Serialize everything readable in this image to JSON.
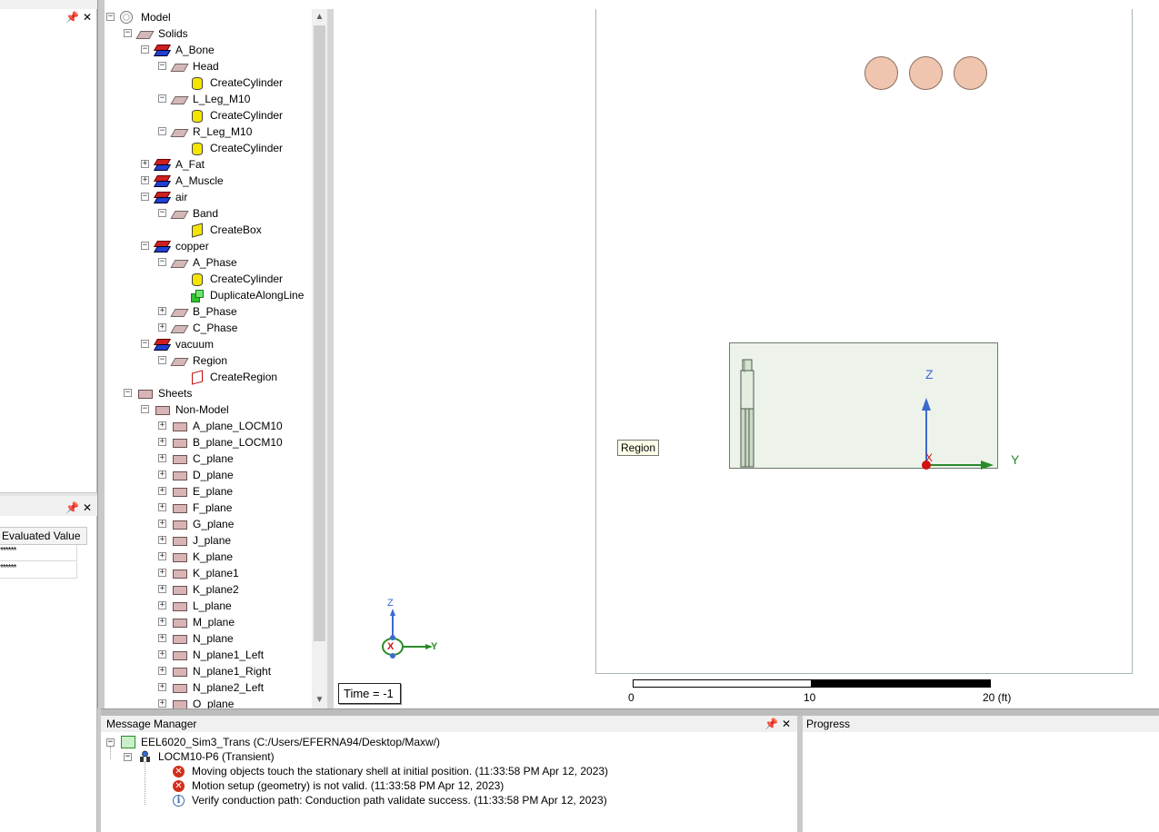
{
  "left_panels": {
    "top": {
      "pin": "📌",
      "close": "✕"
    },
    "bottom": {
      "pin": "📌",
      "close": "✕",
      "column_header": "Evaluated Value",
      "rows": [
        "******",
        "******"
      ]
    }
  },
  "tree": {
    "scroll_up": "▲",
    "scroll_down": "▼",
    "nodes": [
      {
        "label": "Model",
        "expander": "−",
        "icon": "model-icon"
      },
      {
        "label": "Solids",
        "expander": "−",
        "icon": "folder-icon"
      },
      {
        "label": "A_Bone",
        "expander": "−",
        "icon": "material-icon"
      },
      {
        "label": "Head",
        "expander": "−",
        "icon": "object-icon"
      },
      {
        "label": "CreateCylinder",
        "expander": "",
        "icon": "cylinder-icon"
      },
      {
        "label": "L_Leg_M10",
        "expander": "−",
        "icon": "object-icon"
      },
      {
        "label": "CreateCylinder",
        "expander": "",
        "icon": "cylinder-icon"
      },
      {
        "label": "R_Leg_M10",
        "expander": "−",
        "icon": "object-icon"
      },
      {
        "label": "CreateCylinder",
        "expander": "",
        "icon": "cylinder-icon"
      },
      {
        "label": "A_Fat",
        "expander": "+",
        "icon": "material-icon"
      },
      {
        "label": "A_Muscle",
        "expander": "+",
        "icon": "material-icon"
      },
      {
        "label": "air",
        "expander": "−",
        "icon": "material-icon"
      },
      {
        "label": "Band",
        "expander": "−",
        "icon": "object-icon"
      },
      {
        "label": "CreateBox",
        "expander": "",
        "icon": "box-icon"
      },
      {
        "label": "copper",
        "expander": "−",
        "icon": "material-icon"
      },
      {
        "label": "A_Phase",
        "expander": "−",
        "icon": "object-icon"
      },
      {
        "label": "CreateCylinder",
        "expander": "",
        "icon": "cylinder-icon"
      },
      {
        "label": "DuplicateAlongLine",
        "expander": "",
        "icon": "duplicate-icon"
      },
      {
        "label": "B_Phase",
        "expander": "+",
        "icon": "object-icon"
      },
      {
        "label": "C_Phase",
        "expander": "+",
        "icon": "object-icon"
      },
      {
        "label": "vacuum",
        "expander": "−",
        "icon": "material-icon"
      },
      {
        "label": "Region",
        "expander": "−",
        "icon": "object-icon"
      },
      {
        "label": "CreateRegion",
        "expander": "",
        "icon": "region-icon"
      },
      {
        "label": "Sheets",
        "expander": "−",
        "icon": "sheet-icon"
      },
      {
        "label": "Non-Model",
        "expander": "−",
        "icon": "sheet-icon"
      },
      {
        "label": "A_plane_LOCM10",
        "expander": "+",
        "icon": "sheet-icon"
      },
      {
        "label": "B_plane_LOCM10",
        "expander": "+",
        "icon": "sheet-icon"
      },
      {
        "label": "C_plane",
        "expander": "+",
        "icon": "sheet-icon"
      },
      {
        "label": "D_plane",
        "expander": "+",
        "icon": "sheet-icon"
      },
      {
        "label": "E_plane",
        "expander": "+",
        "icon": "sheet-icon"
      },
      {
        "label": "F_plane",
        "expander": "+",
        "icon": "sheet-icon"
      },
      {
        "label": "G_plane",
        "expander": "+",
        "icon": "sheet-icon"
      },
      {
        "label": "J_plane",
        "expander": "+",
        "icon": "sheet-icon"
      },
      {
        "label": "K_plane",
        "expander": "+",
        "icon": "sheet-icon"
      },
      {
        "label": "K_plane1",
        "expander": "+",
        "icon": "sheet-icon"
      },
      {
        "label": "K_plane2",
        "expander": "+",
        "icon": "sheet-icon"
      },
      {
        "label": "L_plane",
        "expander": "+",
        "icon": "sheet-icon"
      },
      {
        "label": "M_plane",
        "expander": "+",
        "icon": "sheet-icon"
      },
      {
        "label": "N_plane",
        "expander": "+",
        "icon": "sheet-icon"
      },
      {
        "label": "N_plane1_Left",
        "expander": "+",
        "icon": "sheet-icon"
      },
      {
        "label": "N_plane1_Right",
        "expander": "+",
        "icon": "sheet-icon"
      },
      {
        "label": "N_plane2_Left",
        "expander": "+",
        "icon": "sheet-icon"
      },
      {
        "label": "O_plane",
        "expander": "+",
        "icon": "sheet-icon"
      }
    ]
  },
  "viewport": {
    "region_tooltip": "Region",
    "axis_z": "Z",
    "axis_y": "Y",
    "axis_x": "X",
    "triad_z": "Z",
    "triad_y": "Y",
    "triad_x": "X",
    "time_label": "Time = -1",
    "scale": {
      "tick0": "0",
      "tick1": "10",
      "tick2": "20 (ft)"
    },
    "colors": {
      "conductor": "#efc5b0",
      "region_fill": "#edf2ea",
      "z_axis": "#3a6ad0",
      "y_axis": "#2a8a2a",
      "origin": "#d01010"
    }
  },
  "message_manager": {
    "title": "Message Manager",
    "pin": "📌",
    "close": "✕",
    "project": "EEL6020_Sim3_Trans (C:/Users/EFERNA94/Desktop/Maxw/)",
    "design": "LOCM10-P6 (Transient)",
    "messages": [
      {
        "type": "error",
        "text": "Moving objects touch the stationary shell at initial position. (11:33:58 PM  Apr 12, 2023)"
      },
      {
        "type": "error",
        "text": "Motion setup (geometry) is not valid. (11:33:58 PM  Apr 12, 2023)"
      },
      {
        "type": "info",
        "text": "Verify conduction path: Conduction path validate success. (11:33:58 PM  Apr 12, 2023)"
      }
    ]
  },
  "progress": {
    "title": "Progress"
  }
}
